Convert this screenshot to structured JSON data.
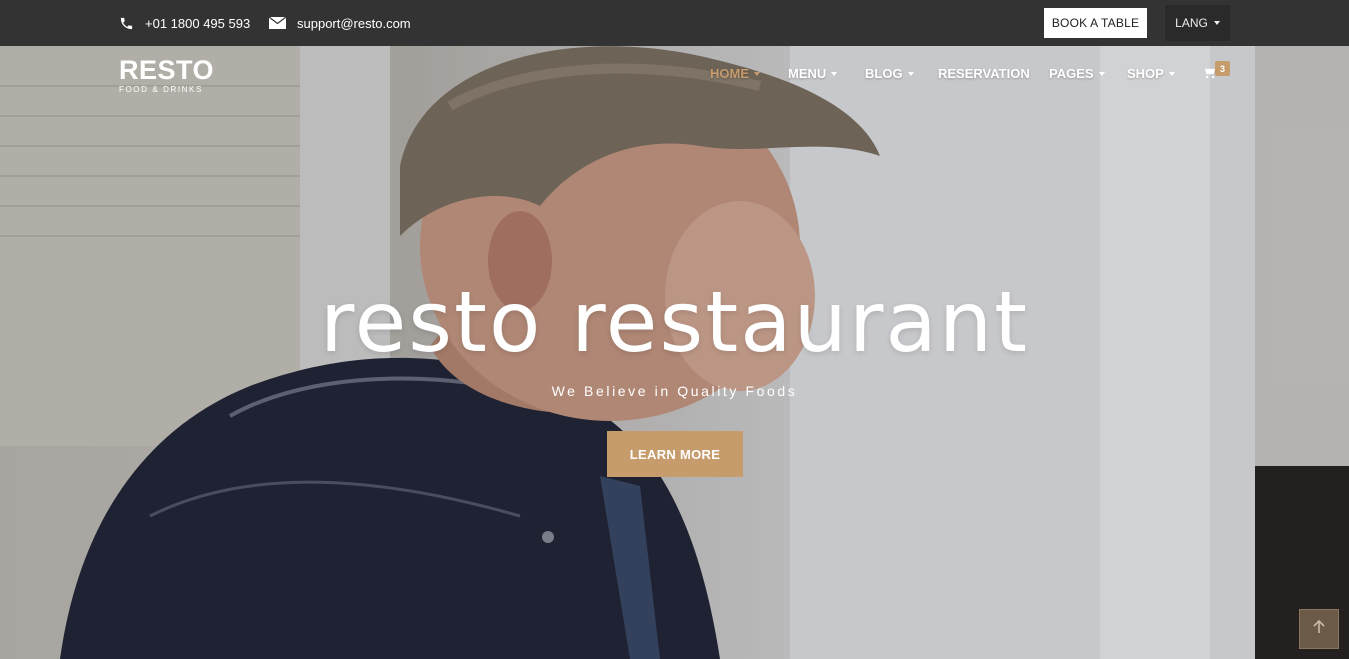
{
  "topbar": {
    "phone": "+01 1800 495 593",
    "email": "support@resto.com",
    "book_label": "BOOK A TABLE",
    "lang_label": "LANG"
  },
  "logo": {
    "name": "RESTO",
    "tagline": "FOOD & DRINKS"
  },
  "nav": {
    "items": [
      {
        "label": "HOME",
        "dropdown": true,
        "active": true
      },
      {
        "label": "MENU",
        "dropdown": true
      },
      {
        "label": "BLOG",
        "dropdown": true
      },
      {
        "label": "RESERVATION",
        "dropdown": false
      },
      {
        "label": "PAGES",
        "dropdown": true
      },
      {
        "label": "SHOP",
        "dropdown": true
      }
    ],
    "cart_count": "3"
  },
  "hero": {
    "title": "resto restaurant",
    "subtitle": "We Believe in Quality Foods",
    "button_label": "LEARN MORE"
  },
  "colors": {
    "accent": "#c69c6d",
    "topbar": "#333333"
  },
  "icons": {
    "phone": "phone-icon",
    "email": "envelope-icon",
    "cart": "cart-icon",
    "back_to_top": "arrow-up-icon"
  }
}
